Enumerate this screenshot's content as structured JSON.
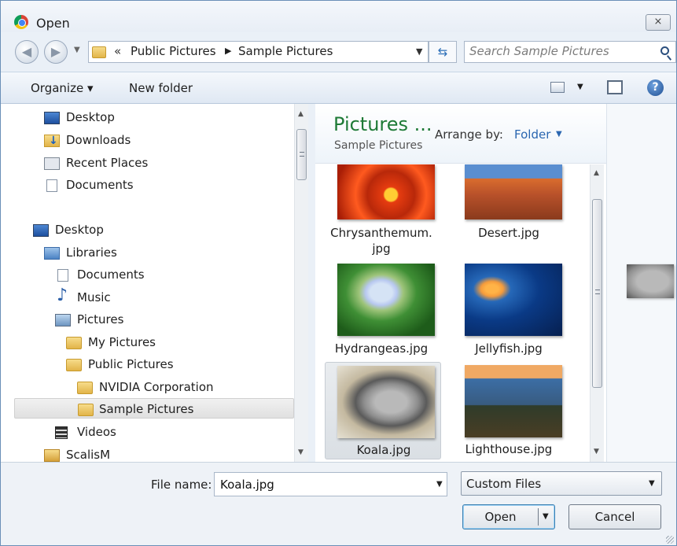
{
  "window": {
    "title": "Open",
    "close_glyph": "⨯"
  },
  "address_bar": {
    "overflow_glyph": "«",
    "breadcrumbs": [
      "Public Pictures",
      "Sample Pictures"
    ],
    "separator_glyph": "▶",
    "search_placeholder": "Search Sample Pictures"
  },
  "toolbar": {
    "organize_label": "Organize ▾",
    "new_folder_label": "New folder",
    "help_glyph": "?"
  },
  "navigation": {
    "favorites": [
      {
        "label": "Desktop",
        "icon": "desktop-icon"
      },
      {
        "label": "Downloads",
        "icon": "downloads-folder-icon"
      },
      {
        "label": "Recent Places",
        "icon": "recent-places-icon"
      },
      {
        "label": "Documents",
        "icon": "document-icon"
      }
    ],
    "tree": [
      {
        "label": "Desktop",
        "icon": "desktop-icon",
        "level": 0
      },
      {
        "label": "Libraries",
        "icon": "libraries-icon",
        "level": 1
      },
      {
        "label": "Documents",
        "icon": "document-icon",
        "level": 2
      },
      {
        "label": "Music",
        "icon": "music-icon",
        "level": 2
      },
      {
        "label": "Pictures",
        "icon": "pictures-icon",
        "level": 2
      },
      {
        "label": "My Pictures",
        "icon": "folder-icon",
        "level": 3
      },
      {
        "label": "Public Pictures",
        "icon": "folder-icon",
        "level": 3
      },
      {
        "label": "NVIDIA Corporation",
        "icon": "folder-icon",
        "level": 4
      },
      {
        "label": "Sample Pictures",
        "icon": "folder-icon",
        "level": 4,
        "selected": true
      },
      {
        "label": "Videos",
        "icon": "video-icon",
        "level": 2
      },
      {
        "label": "ScalisM",
        "icon": "user-folder-icon",
        "level": 1
      }
    ]
  },
  "content": {
    "library_title": "Pictures ...",
    "library_subtitle": "Sample Pictures",
    "arrange_label": "Arrange by:",
    "arrange_value": "Folder",
    "items": [
      {
        "name": "Chrysanthemum.",
        "name2": "jpg"
      },
      {
        "name": "Desert.jpg"
      },
      {
        "name": "Hydrangeas.jpg"
      },
      {
        "name": "Jellyfish.jpg"
      },
      {
        "name": "Koala.jpg",
        "selected": true
      },
      {
        "name": "Lighthouse.jpg"
      }
    ]
  },
  "footer": {
    "file_name_label": "File name:",
    "file_name_value": "Koala.jpg",
    "file_type_value": "Custom Files",
    "open_label": "Open",
    "cancel_label": "Cancel"
  },
  "colors": {
    "library_title": "#1e7a36",
    "link_blue": "#2a66b0",
    "frame": "#6a8fb7"
  }
}
